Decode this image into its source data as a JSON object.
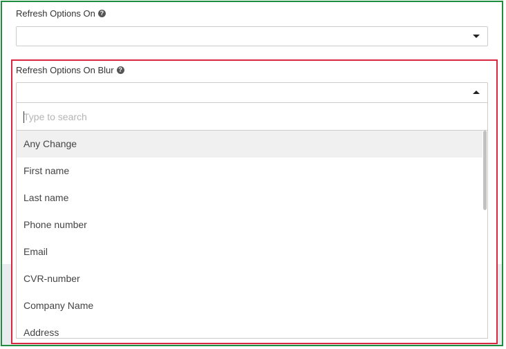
{
  "field_one": {
    "label": "Refresh Options On",
    "help_icon": "question-circle-icon",
    "value": ""
  },
  "field_two": {
    "label": "Refresh Options On Blur",
    "help_icon": "question-circle-icon",
    "value": ""
  },
  "dropdown": {
    "search_placeholder": "Type to search",
    "search_value": "",
    "options": [
      {
        "label": "Any Change",
        "highlighted": true
      },
      {
        "label": "First name"
      },
      {
        "label": "Last name"
      },
      {
        "label": "Phone number"
      },
      {
        "label": "Email"
      },
      {
        "label": "CVR-number"
      },
      {
        "label": "Company Name"
      },
      {
        "label": "Address"
      }
    ]
  },
  "colors": {
    "outer_border": "#1e8e3e",
    "highlight_border": "#d7263d",
    "highlighted_option": "#f0f0f0"
  }
}
